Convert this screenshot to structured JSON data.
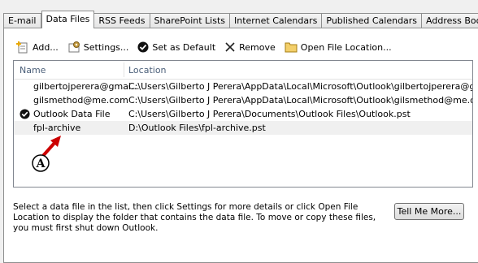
{
  "tabs": [
    "E-mail",
    "Data Files",
    "RSS Feeds",
    "SharePoint Lists",
    "Internet Calendars",
    "Published Calendars",
    "Address Books"
  ],
  "toolbar": {
    "add": "Add...",
    "settings": "Settings...",
    "set_default": "Set as Default",
    "remove": "Remove",
    "open_location": "Open File Location..."
  },
  "list": {
    "col_name": "Name",
    "col_location": "Location",
    "rows": [
      {
        "name": "gilbertojperera@gmai...",
        "location": "C:\\Users\\Gilberto J Perera\\AppData\\Local\\Microsoft\\Outlook\\gilbertojperera@gm..."
      },
      {
        "name": "gilsmethod@me.com",
        "location": "C:\\Users\\Gilberto J Perera\\AppData\\Local\\Microsoft\\Outlook\\gilsmethod@me.com..."
      },
      {
        "name": "Outlook Data File",
        "location": "C:\\Users\\Gilberto J Perera\\Documents\\Outlook Files\\Outlook.pst"
      },
      {
        "name": "fpl-archive",
        "location": "D:\\Outlook Files\\fpl-archive.pst"
      }
    ]
  },
  "annotation": "A",
  "info": "Select a data file in the list, then click Settings for more details or click Open File Location to display the folder that contains the data file. To move or copy these files, you must first shut down Outlook.",
  "tell_me_more": "Tell Me More..."
}
